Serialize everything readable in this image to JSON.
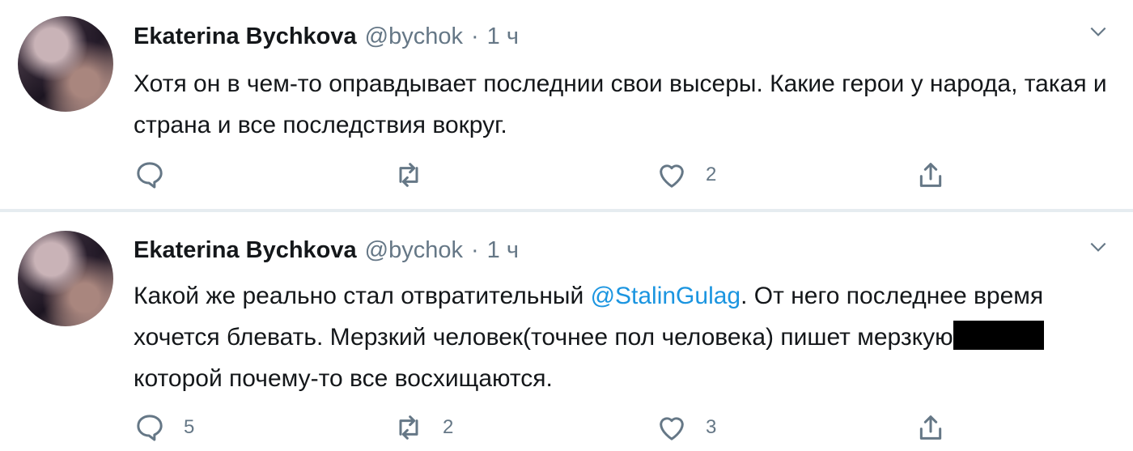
{
  "tweets": [
    {
      "author_name": "Ekaterina Bychkova",
      "handle": "@bychok",
      "separator": "·",
      "time": "1 ч",
      "text": "Хотя он в чем-то оправдывает последнии свои высеры. Какие герои у народа, такая и страна и все последствия вокруг.",
      "reply_count": "",
      "retweet_count": "",
      "like_count": "2"
    },
    {
      "author_name": "Ekaterina Bychkova",
      "handle": "@bychok",
      "separator": "·",
      "time": "1 ч",
      "text_before": "Какой же реально стал отвратительный ",
      "mention": "@StalinGulag",
      "text_middle": ". От него последнее время хочется блевать. Мерзкий человек(точнее пол человека) пишет мерзкую",
      "text_after": "которой почему-то все восхищаются.",
      "reply_count": "5",
      "retweet_count": "2",
      "like_count": "3"
    }
  ],
  "icons": {
    "reply": "reply-icon",
    "retweet": "retweet-icon",
    "like": "heart-icon",
    "share": "share-icon",
    "caret": "chevron-down-icon"
  },
  "colors": {
    "mention": "#1b95e0",
    "secondary_text": "#657786",
    "divider": "#e6ecf0"
  }
}
